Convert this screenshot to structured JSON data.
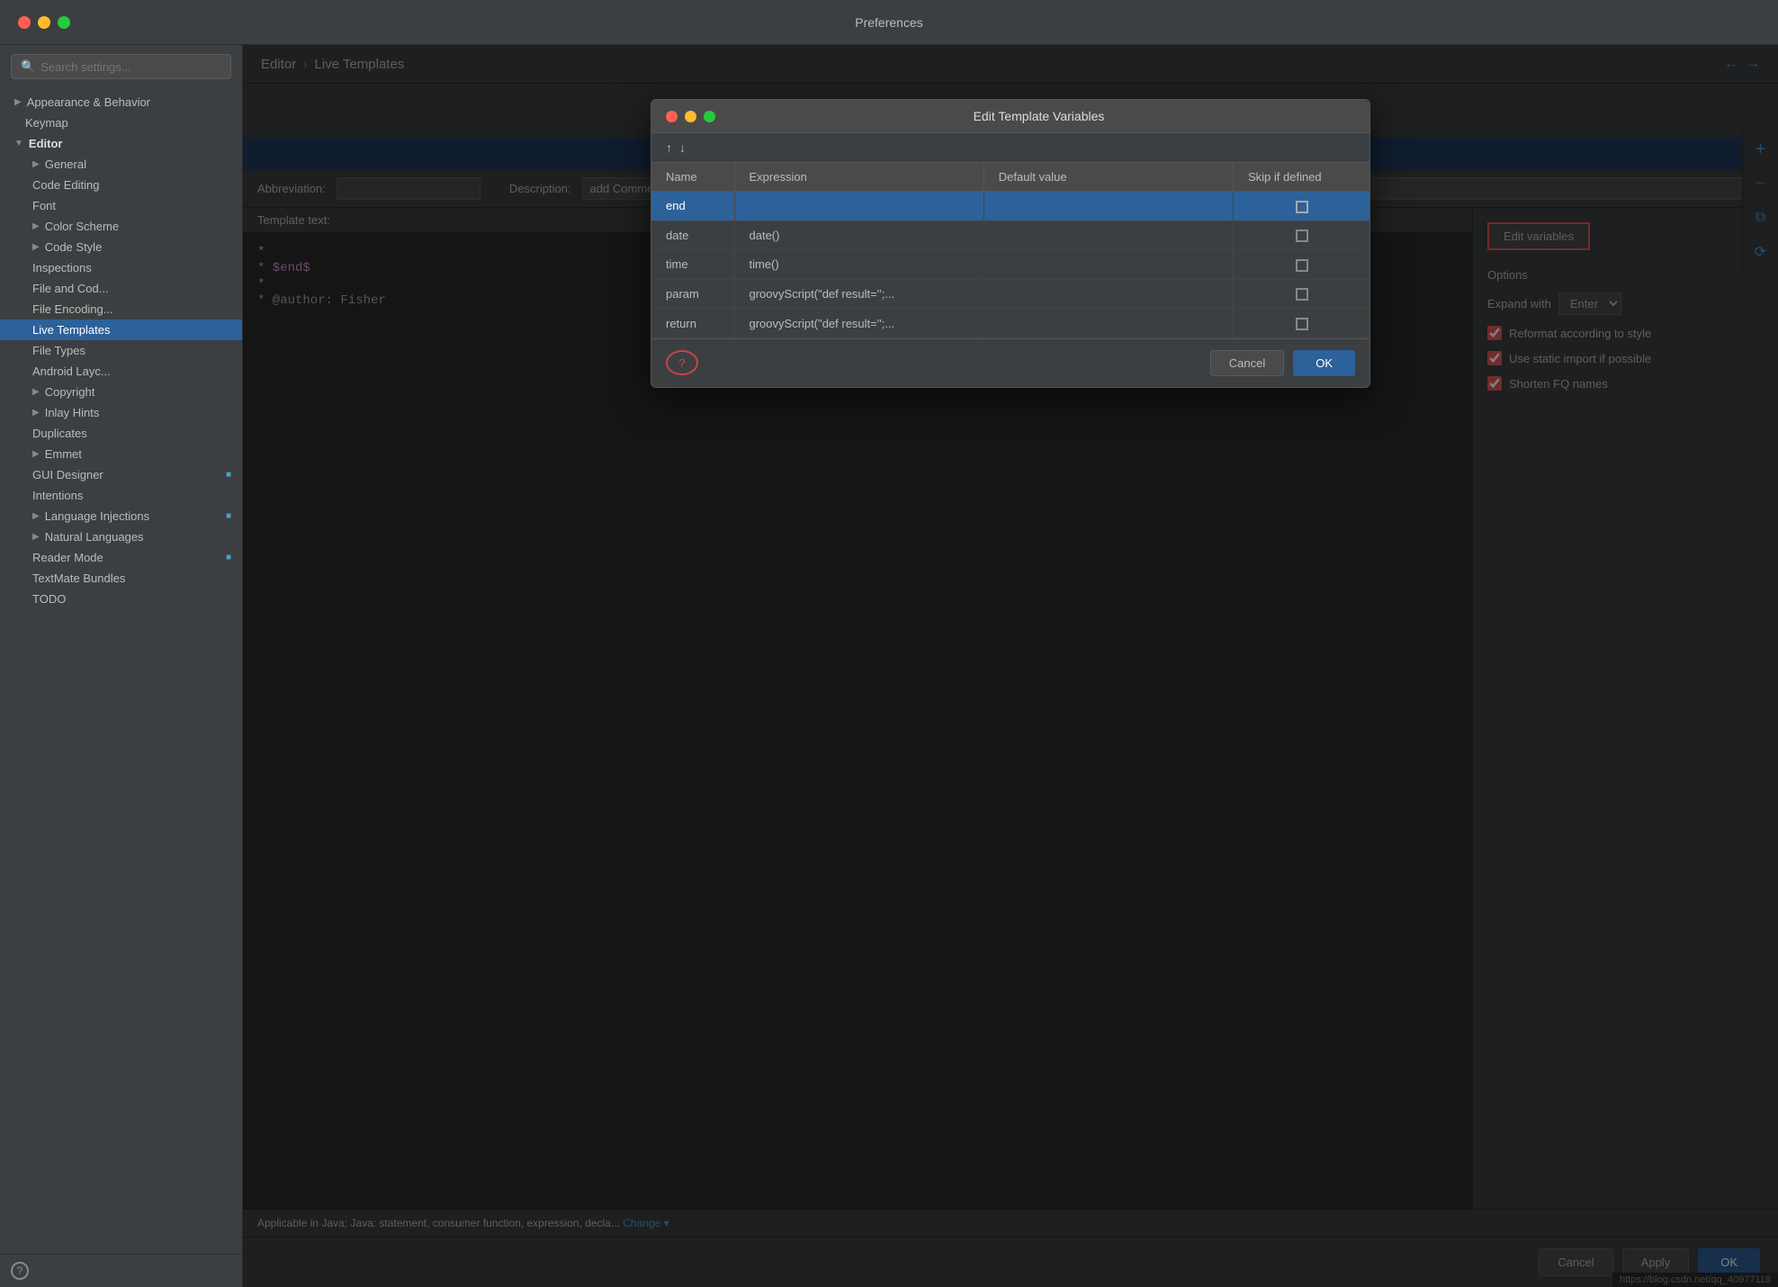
{
  "window": {
    "title": "Preferences"
  },
  "sidebar": {
    "search_placeholder": "Search settings...",
    "items": [
      {
        "id": "appearance-behavior",
        "label": "Appearance & Behavior",
        "level": 0,
        "expanded": false,
        "arrow": "▶"
      },
      {
        "id": "keymap",
        "label": "Keymap",
        "level": 0,
        "expanded": false,
        "arrow": ""
      },
      {
        "id": "editor",
        "label": "Editor",
        "level": 0,
        "expanded": true,
        "arrow": "▼"
      },
      {
        "id": "general",
        "label": "General",
        "level": 1,
        "expanded": false,
        "arrow": "▶"
      },
      {
        "id": "code-editing",
        "label": "Code Editing",
        "level": 1,
        "expanded": false,
        "arrow": ""
      },
      {
        "id": "font",
        "label": "Font",
        "level": 1,
        "expanded": false,
        "arrow": ""
      },
      {
        "id": "color-scheme",
        "label": "Color Scheme",
        "level": 1,
        "expanded": false,
        "arrow": "▶"
      },
      {
        "id": "code-style",
        "label": "Code Style",
        "level": 1,
        "expanded": false,
        "arrow": "▶"
      },
      {
        "id": "inspections",
        "label": "Inspections",
        "level": 1,
        "expanded": false,
        "arrow": ""
      },
      {
        "id": "file-and-code",
        "label": "File and Cod...",
        "level": 1,
        "expanded": false,
        "arrow": ""
      },
      {
        "id": "file-encodings",
        "label": "File Encoding...",
        "level": 1,
        "expanded": false,
        "arrow": ""
      },
      {
        "id": "live-templates",
        "label": "Live Templates",
        "level": 1,
        "expanded": false,
        "arrow": "",
        "active": true
      },
      {
        "id": "file-types",
        "label": "File Types",
        "level": 1,
        "expanded": false,
        "arrow": ""
      },
      {
        "id": "android-layout",
        "label": "Android Layc...",
        "level": 1,
        "expanded": false,
        "arrow": ""
      },
      {
        "id": "copyright",
        "label": "Copyright",
        "level": 1,
        "expanded": false,
        "arrow": "▶"
      },
      {
        "id": "inlay-hints",
        "label": "Inlay Hints",
        "level": 1,
        "expanded": false,
        "arrow": "▶"
      },
      {
        "id": "duplicates",
        "label": "Duplicates",
        "level": 1,
        "expanded": false,
        "arrow": ""
      },
      {
        "id": "emmet",
        "label": "Emmet",
        "level": 1,
        "expanded": false,
        "arrow": "▶"
      },
      {
        "id": "gui-designer",
        "label": "GUI Designer",
        "level": 1,
        "expanded": false,
        "arrow": "",
        "badge": "■"
      },
      {
        "id": "intentions",
        "label": "Intentions",
        "level": 1,
        "expanded": false,
        "arrow": ""
      },
      {
        "id": "language-injections",
        "label": "Language Injections",
        "level": 1,
        "expanded": false,
        "arrow": "▶",
        "badge": "■"
      },
      {
        "id": "natural-languages",
        "label": "Natural Languages",
        "level": 1,
        "expanded": false,
        "arrow": "▶"
      },
      {
        "id": "reader-mode",
        "label": "Reader Mode",
        "level": 1,
        "expanded": false,
        "arrow": "",
        "badge": "■"
      },
      {
        "id": "textmate-bundles",
        "label": "TextMate Bundles",
        "level": 1,
        "expanded": false,
        "arrow": ""
      },
      {
        "id": "todo",
        "label": "TODO",
        "level": 1,
        "expanded": false,
        "arrow": ""
      }
    ]
  },
  "breadcrumb": {
    "parent": "Editor",
    "separator": "›",
    "current": "Live Templates"
  },
  "toolbar": {
    "add_icon": "+",
    "remove_icon": "−",
    "copy_icon": "⧉",
    "history_icon": "⟳"
  },
  "template": {
    "abbreviation_label": "Abbreviation:",
    "abbreviation_value": "",
    "description_label": "Description:",
    "description_value": "add Comment for method",
    "template_text_label": "Template text:",
    "template_code_lines": [
      {
        "text": "*",
        "style": "normal"
      },
      {
        "text": " * $end$",
        "style": "purple"
      },
      {
        "text": " *",
        "style": "normal"
      },
      {
        "text": " * @author: Fisher",
        "style": "normal"
      }
    ],
    "edit_variables_label": "Edit variables",
    "applicable_text": "Applicable in Java; Java: statement, consumer function, expression, decla...",
    "change_label": "Change",
    "options_title": "Options",
    "expand_with_label": "Expand with",
    "expand_with_value": "Enter",
    "checkboxes": [
      {
        "id": "reformat",
        "label": "Reformat according to style",
        "checked": true
      },
      {
        "id": "static-import",
        "label": "Use static import if possible",
        "checked": true
      },
      {
        "id": "shorten-fq",
        "label": "Shorten FQ names",
        "checked": true
      }
    ]
  },
  "modal": {
    "title": "Edit Template Variables",
    "columns": [
      "Name",
      "Expression",
      "Default value",
      "Skip if defined"
    ],
    "rows": [
      {
        "name": "end",
        "expression": "",
        "default": "",
        "skip": false,
        "selected": true
      },
      {
        "name": "date",
        "expression": "date()",
        "default": "",
        "skip": false
      },
      {
        "name": "time",
        "expression": "time()",
        "default": "",
        "skip": false
      },
      {
        "name": "param",
        "expression": "groovyScript(\"def result='';...",
        "default": "",
        "skip": false
      },
      {
        "name": "return",
        "expression": "groovyScript(\"def result='';...",
        "default": "",
        "skip": false
      }
    ],
    "cancel_label": "Cancel",
    "ok_label": "OK"
  },
  "bottom_bar": {
    "cancel_label": "Cancel",
    "apply_label": "Apply",
    "ok_label": "OK"
  },
  "url_bar": "https://blog.csdn.net/qq_40977118"
}
